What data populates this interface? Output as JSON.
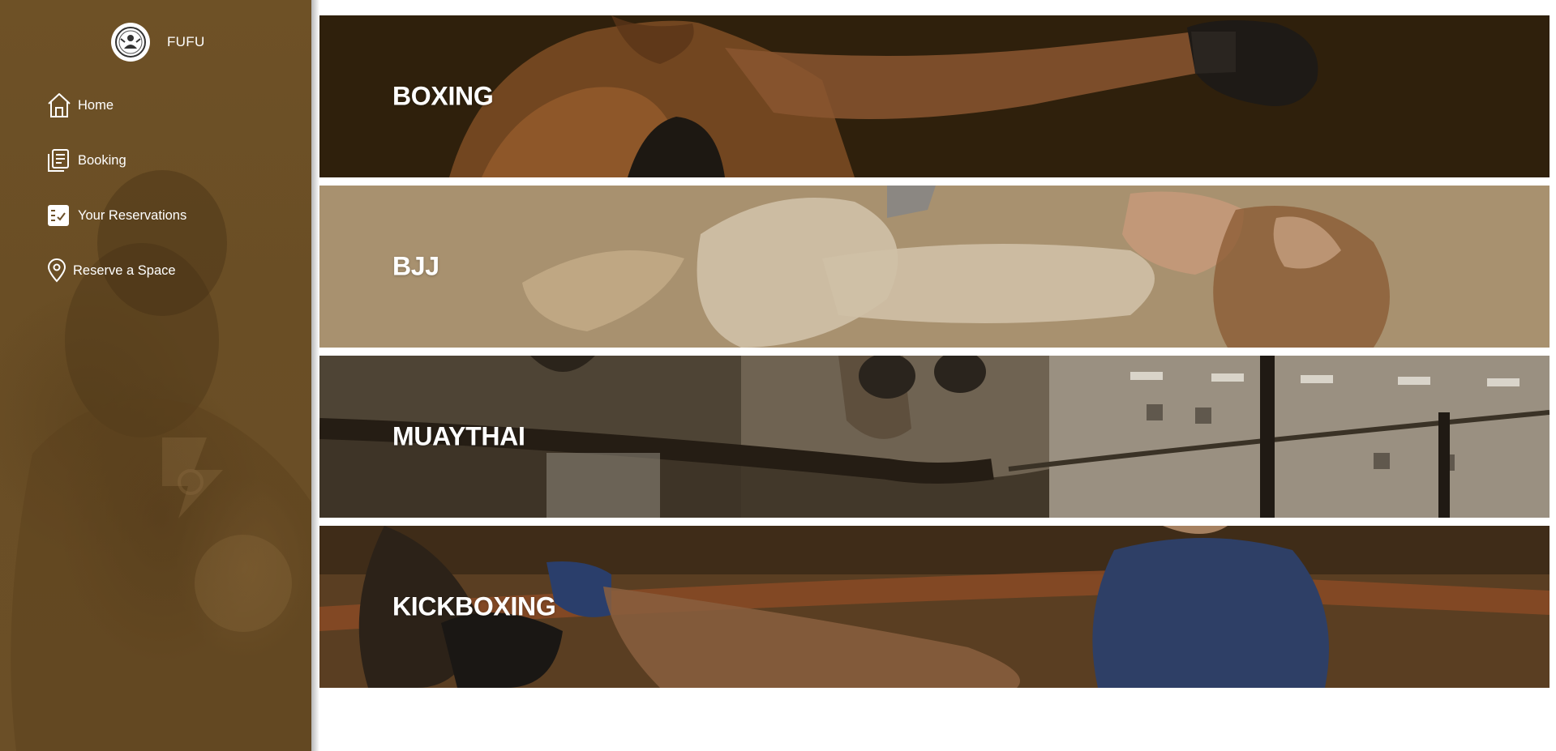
{
  "brand": {
    "name": "FUFU",
    "logo_icon": "fighter-emblem-icon"
  },
  "sidebar": {
    "items": [
      {
        "label": "Home",
        "icon": "home-icon"
      },
      {
        "label": "Booking",
        "icon": "document-list-icon"
      },
      {
        "label": "Your Reservations",
        "icon": "checklist-icon"
      },
      {
        "label": "Reserve a Space",
        "icon": "location-pin-icon"
      }
    ]
  },
  "banners": [
    {
      "title": "BOXING"
    },
    {
      "title": "BJJ"
    },
    {
      "title": "MUAYTHAI"
    },
    {
      "title": "KICKBOXING"
    }
  ],
  "colors": {
    "sidebar_bg": "#6b4f27",
    "text": "#ffffff",
    "boxing_bg": "#2f200c",
    "bjj_bg": "#a8916f",
    "muaythai_bg": "#6f6352",
    "kickboxing_bg": "#5a3e22"
  }
}
